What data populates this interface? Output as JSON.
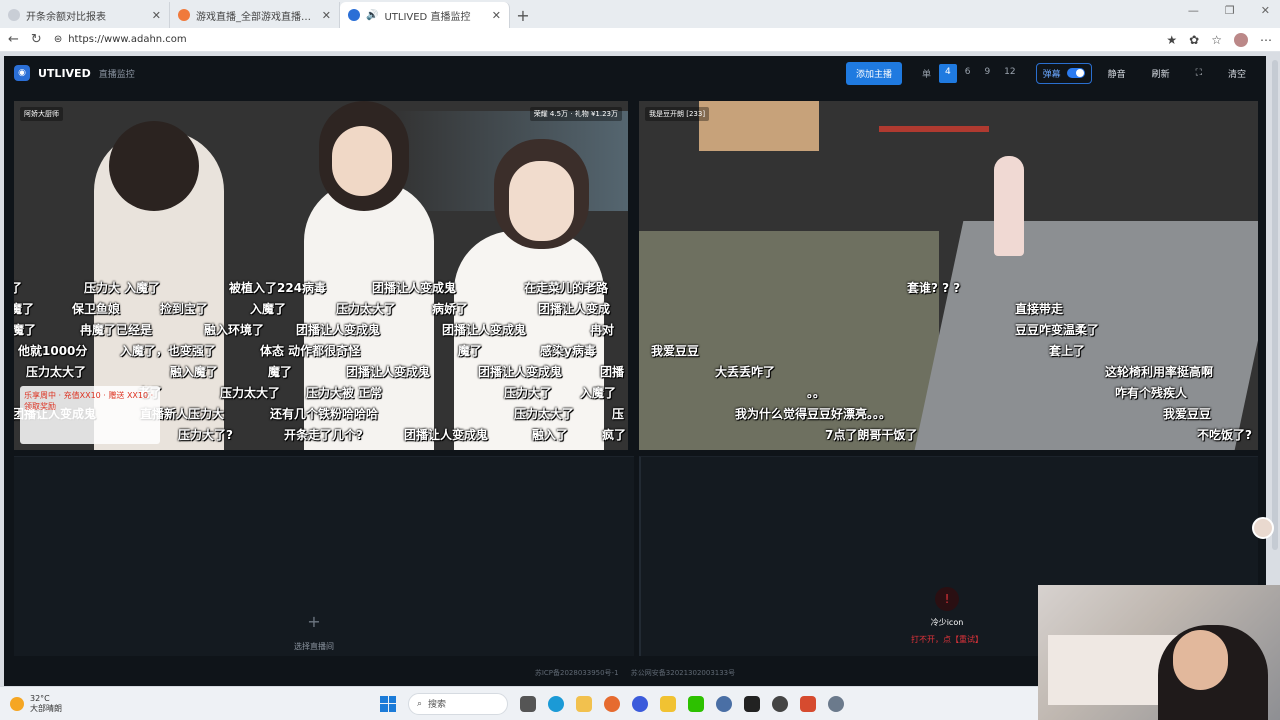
{
  "browser": {
    "tabs": [
      {
        "title": "开条余额对比报表",
        "active": false
      },
      {
        "title": "游戏直播_全部游戏直播_斗鱼直播",
        "active": false
      },
      {
        "title": "UTLIVED 直播监控",
        "active": true
      }
    ],
    "url": "https://www.adahn.com"
  },
  "app": {
    "brand": "UTLIVED",
    "brand_sub": "直播监控",
    "add_label": "添加主播",
    "layouts": [
      "单",
      "4",
      "6",
      "9",
      "12"
    ],
    "layout_selected": "4",
    "danmu_label": "弹幕",
    "mute_label": "静音",
    "refresh_label": "刷新",
    "fullscreen_glyph": "⛶",
    "clear_label": "清空",
    "accent_color": "#1f7ae0"
  },
  "streams": [
    {
      "tag": "阿娇大厨师",
      "stat": "荣耀 4.5万 · 礼物 ¥1.23万",
      "danmu": [
        "了",
        "压力大 入魔了",
        "被植入了224病毒",
        "团播让人变成鬼",
        "在走菜儿的老路",
        "魔了",
        "保卫鱼娘",
        "捡到宝了",
        "入魔了",
        "压力太大了",
        "病娇了",
        "团播让人变成",
        "魔了",
        "冉魔了已经是",
        "融入环境了",
        "团播让人变成鬼",
        "团播让人变成鬼",
        "冉对",
        "他就1000分",
        "入魔了，也变强了",
        "体态 动作都很奇怪",
        "魔了",
        "感染y病毒",
        "压力太大了",
        "融入魔了",
        "魔了",
        "团播让人变成鬼",
        "团播让人变成鬼",
        "团播",
        "老了",
        "压力太大了",
        "压力大被 正常",
        "压力大了",
        "入魔了",
        "团播让人变成鬼",
        "直播新人压力大",
        "还有几个铁粉哈哈哈",
        "压力太大了",
        "压",
        "压力大了?",
        "开条走了几个?",
        "团播让人变成鬼",
        "融入了",
        "疯了"
      ],
      "promo": "乐享周中 · 充值XX10 · 赠送 XX10 · 领取奖励"
    },
    {
      "tag": "我是豆开朗 [233]",
      "danmu": [
        "套谁? ? ?",
        "直接带走",
        "豆豆咋变温柔了",
        "我爱豆豆",
        "套上了",
        "大丢丢咋了",
        "这轮椅利用率挺高啊",
        "咋有个残疾人",
        "。。",
        "我为什么觉得豆豆好漂亮。。。",
        "我爱豆豆",
        "7点了朗哥干饭了",
        "不吃饭了?"
      ]
    }
  ],
  "empty_slot": {
    "label": "选择直播间",
    "plus": "+"
  },
  "error_slot": {
    "icon": "!",
    "title": "冷少icon",
    "hint": "打不开，点【重试】"
  },
  "footer": {
    "icp": "苏ICP备2028033950号-1",
    "police": "苏公网安备32021302003133号"
  },
  "taskbar": {
    "temp": "32°C",
    "weather": "大部晴朗",
    "search": "搜索"
  }
}
